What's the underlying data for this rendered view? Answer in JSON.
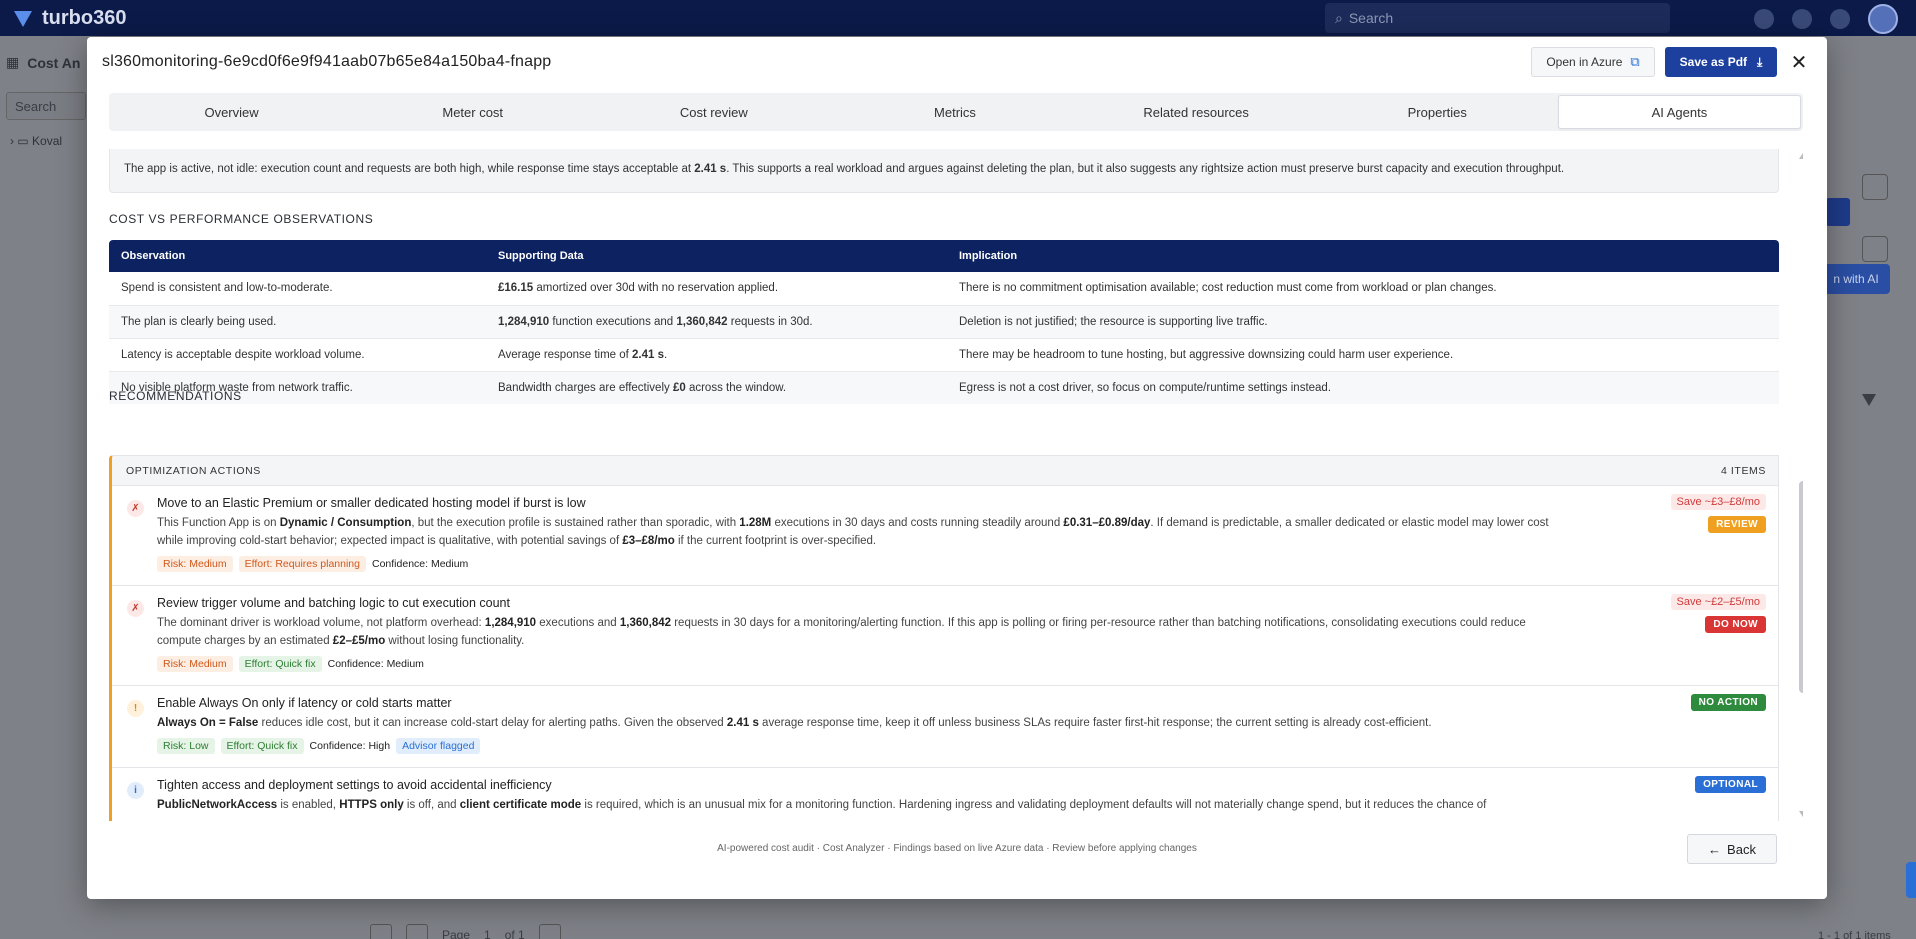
{
  "app": {
    "brand": "turbo360",
    "search_placeholder": "Search",
    "bg_title": "Cost An",
    "bg_search": "Search",
    "bg_tree_item": "Koval",
    "bg_ai_button": "n with AI",
    "bg_page_label": "Page",
    "bg_page_num": "1",
    "bg_of": "of 1",
    "bg_items": "1 - 1 of 1 items"
  },
  "modal": {
    "title": "sl360monitoring-6e9cd0f6e9f941aab07b65e84a150ba4-fnapp",
    "open_azure_label": "Open in Azure",
    "save_pdf_label": "Save as Pdf",
    "close_glyph": "✕",
    "tabs": [
      {
        "label": "Overview"
      },
      {
        "label": "Meter cost"
      },
      {
        "label": "Cost review"
      },
      {
        "label": "Metrics"
      },
      {
        "label": "Related resources"
      },
      {
        "label": "Properties"
      },
      {
        "label": "AI Agents",
        "active": true
      }
    ],
    "callout": {
      "pre": "The app is active, not idle: execution count and requests are both high, while response time stays acceptable at ",
      "bold": "2.41 s",
      "post": ". This supports a real workload and argues against deleting the plan, but it also suggests any rightsize action must preserve burst capacity and execution throughput."
    },
    "observations": {
      "heading": "COST VS PERFORMANCE OBSERVATIONS",
      "columns": [
        "Observation",
        "Supporting Data",
        "Implication"
      ],
      "rows": [
        {
          "observation": "Spend is consistent and low-to-moderate.",
          "data_b1": "£16.15",
          "data_t1": " amortized over 30d with no reservation applied.",
          "data_b2": "",
          "data_t2": "",
          "implication": "There is no commitment optimisation available; cost reduction must come from workload or plan changes."
        },
        {
          "observation": "The plan is clearly being used.",
          "data_b1": "1,284,910",
          "data_t1": " function executions and ",
          "data_b2": "1,360,842",
          "data_t2": " requests in 30d.",
          "implication": "Deletion is not justified; the resource is supporting live traffic."
        },
        {
          "observation": "Latency is acceptable despite workload volume.",
          "data_pre": "Average response time of ",
          "data_b1": "2.41 s",
          "data_t1": ".",
          "data_b2": "",
          "data_t2": "",
          "implication": "There may be headroom to tune hosting, but aggressive downsizing could harm user experience."
        },
        {
          "observation": "No visible platform waste from network traffic.",
          "data_pre": "Bandwidth charges are effectively ",
          "data_b1": "£0",
          "data_t1": " across the window.",
          "data_b2": "",
          "data_t2": "",
          "implication": "Egress is not a cost driver, so focus on compute/runtime settings instead."
        }
      ]
    },
    "recommendations": {
      "heading": "RECOMMENDATIONS",
      "panel_title": "OPTIMIZATION ACTIONS",
      "count": "4 ITEMS",
      "items": [
        {
          "icon": "✗",
          "title": "Move to an Elastic Premium or smaller dedicated hosting model if burst is low",
          "save": "Save ~£3–£8/mo",
          "status": "REVIEW",
          "desc": [
            "This Function App is on ",
            "Dynamic / Consumption",
            ", but the execution profile is sustained rather than sporadic, with ",
            "1.28M",
            " executions in 30 days and costs running steadily around ",
            "£0.31–£0.89/day",
            ". If demand is predictable, a smaller dedicated or elastic model may lower cost while improving cold-start behavior; expected impact is qualitative, with potential savings of ",
            "£3–£8/mo",
            " if the current footprint is over-specified."
          ],
          "risk": "Risk: Medium",
          "effort": "Effort: Requires planning",
          "confidence": "Confidence: Medium"
        },
        {
          "icon": "✗",
          "title": "Review trigger volume and batching logic to cut execution count",
          "save": "Save ~£2–£5/mo",
          "status": "DO NOW",
          "desc": [
            "The dominant driver is workload volume, not platform overhead: ",
            "1,284,910",
            " executions and ",
            "1,360,842",
            " requests in 30 days for a monitoring/alerting function. If this app is polling or firing per-resource rather than batching notifications, consolidating executions could reduce compute charges by an estimated ",
            "£2–£5/mo",
            " without losing functionality."
          ],
          "risk": "Risk: Medium",
          "effort": "Effort: Quick fix",
          "confidence": "Confidence: Medium"
        },
        {
          "icon": "!",
          "title": "Enable Always On only if latency or cold starts matter",
          "status": "NO ACTION",
          "desc": [
            "",
            "Always On = False",
            " reduces idle cost, but it can increase cold-start delay for alerting paths. Given the observed ",
            "2.41 s",
            " average response time, keep it off unless business SLAs require faster first-hit response; the current setting is already cost-efficient."
          ],
          "risk": "Risk: Low",
          "effort": "Effort: Quick fix",
          "confidence": "Confidence: High",
          "advisor": "Advisor flagged"
        },
        {
          "icon": "i",
          "title": "Tighten access and deployment settings to avoid accidental inefficiency",
          "status": "OPTIONAL",
          "desc": [
            "",
            "PublicNetworkAccess",
            " is enabled, ",
            "HTTPS only",
            " is off, and ",
            "client certificate mode",
            " is required, which is an unusual mix for a monitoring function. Hardening ingress and validating deployment defaults will not materially change spend, but it reduces the chance of"
          ]
        }
      ]
    },
    "footer_note": "AI-powered cost audit · Cost Analyzer · Findings based on live Azure data · Review before applying changes",
    "back_label": "Back"
  }
}
